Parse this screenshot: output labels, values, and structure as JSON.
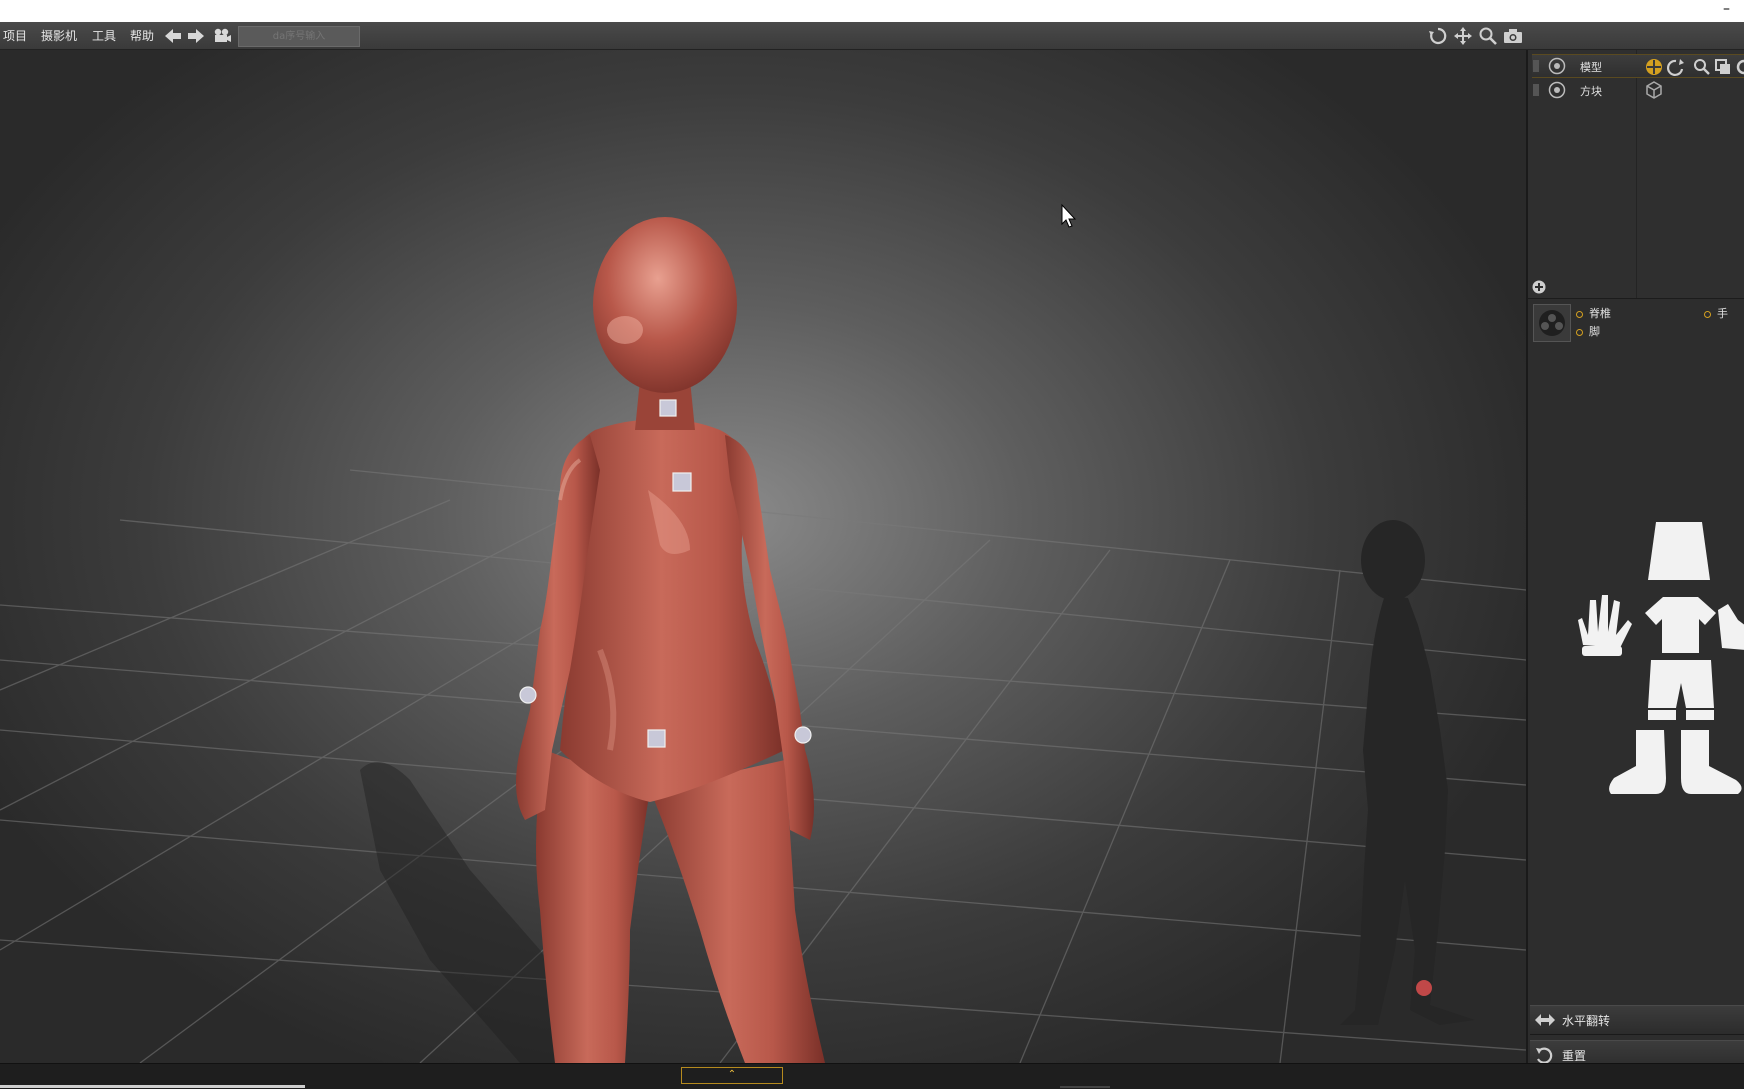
{
  "window": {
    "minimize_glyph": "–"
  },
  "menubar": {
    "items": [
      "项目",
      "摄影机",
      "工具",
      "帮助"
    ],
    "search_placeholder": "da序号输入",
    "icons": [
      "back-arrow-icon",
      "forward-arrow-icon",
      "camera-icon",
      "rotate-icon",
      "move-icon",
      "zoom-icon",
      "screenshot-icon"
    ]
  },
  "layers": [
    {
      "label": "模型",
      "active": true
    },
    {
      "label": "方块",
      "active": false
    }
  ],
  "joints": {
    "spine": "脊椎",
    "hand": "手",
    "foot": "脚"
  },
  "buttons": {
    "flip": "水平翻转",
    "reset": "重置"
  },
  "statusbar": {
    "toggle_glyph": "⌃"
  },
  "colors": {
    "accent": "#d4a020",
    "model_skin": "#b8584a",
    "joint_marker": "#c04848"
  }
}
